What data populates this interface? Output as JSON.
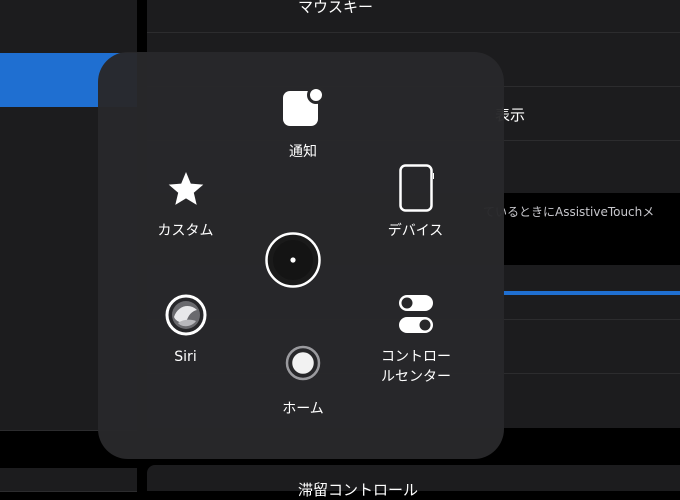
{
  "settings": {
    "mouse_keys_label": "マウスキー",
    "show_menu_partial": "表示",
    "footer_partial": "ているときにAssistiveTouchメ",
    "dwell_control_partial": "滞留コントロール"
  },
  "assistive_menu": {
    "notifications": "通知",
    "custom": "カスタム",
    "device": "デバイス",
    "siri": "Siri",
    "control_center_line1": "コントロー",
    "control_center_line2": "ルセンター",
    "home": "ホーム"
  },
  "colors": {
    "accent": "#1f6fd1",
    "menu_background": "#28282a"
  }
}
